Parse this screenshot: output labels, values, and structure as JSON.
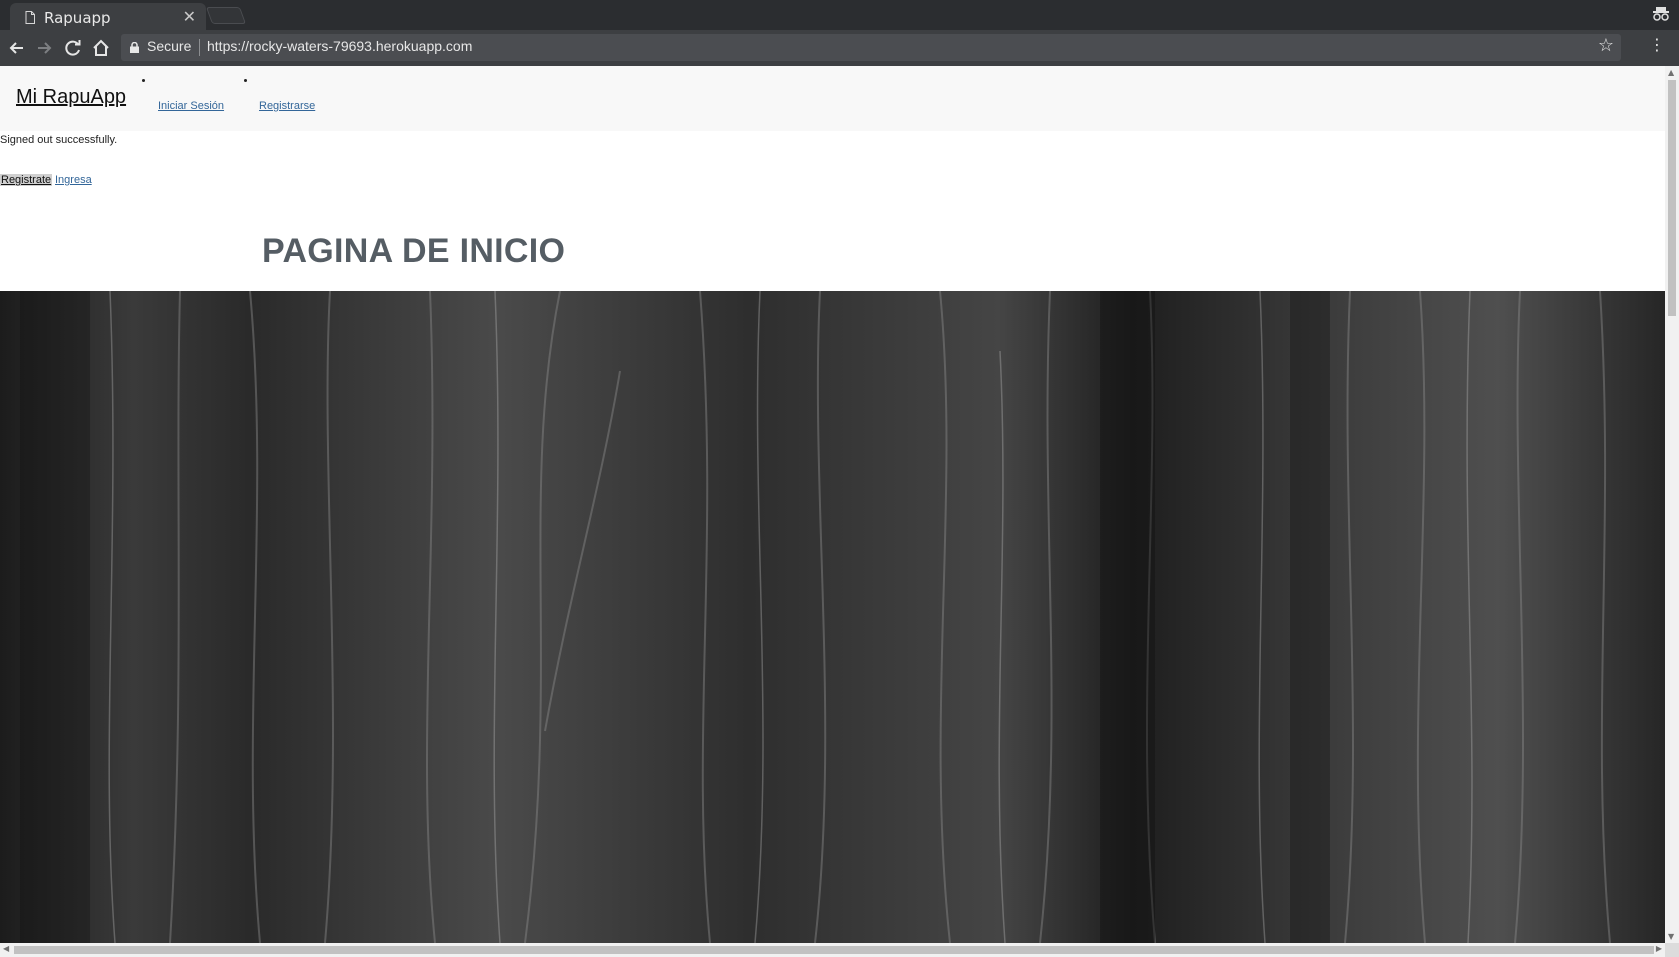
{
  "browser": {
    "tab_title": "Rapuapp",
    "secure_label": "Secure",
    "url": "https://rocky-waters-79693.herokuapp.com"
  },
  "navbar": {
    "brand": "Mi RapuApp",
    "links": [
      {
        "label": "Iniciar Sesión"
      },
      {
        "label": "Registrarse"
      }
    ]
  },
  "flash": {
    "notice": "Signed out successfully."
  },
  "actions": {
    "registrate": "Registrate",
    "ingresa": "Ingresa"
  },
  "main": {
    "heading": "PAGINA DE INICIO"
  },
  "icons": {
    "tab_icon": "page-icon",
    "close": "close-icon",
    "back": "back-arrow-icon",
    "forward": "forward-arrow-icon",
    "reload": "reload-icon",
    "home": "home-icon",
    "lock": "lock-icon",
    "bookmark": "star-icon",
    "menu": "more-vert-icon",
    "incognito": "incognito-icon"
  },
  "colors": {
    "chrome_dark": "#2b2d30",
    "toolbar": "#3d3f42",
    "link": "#336699",
    "heading": "#555d64"
  }
}
